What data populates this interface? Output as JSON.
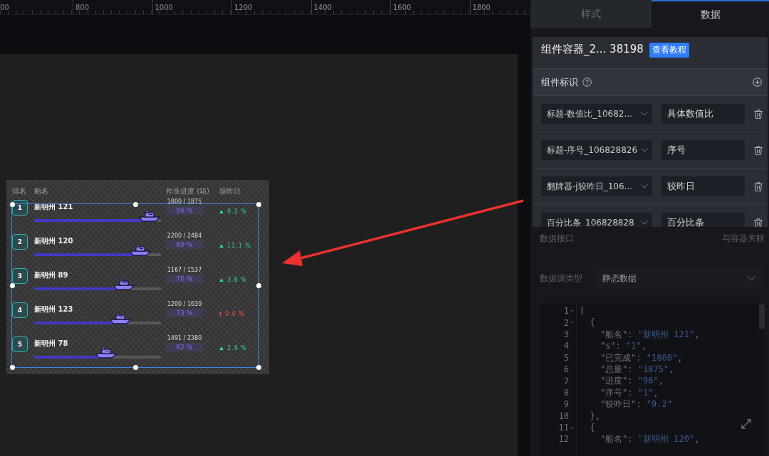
{
  "ruler": {
    "labels": [
      "00",
      "800",
      "1000",
      "1200",
      "1400",
      "1600",
      "1800"
    ]
  },
  "widget": {
    "columns": [
      "排名",
      "船名",
      "作业进度 (箱)",
      "较昨日"
    ],
    "rows": [
      {
        "rank": "1",
        "name": "新明州 121",
        "progress": "1800 / 1875",
        "level": 0.96,
        "percent": "96 %",
        "change": "9.2 %",
        "kind": "up"
      },
      {
        "rank": "2",
        "name": "新明州 120",
        "progress": "2200 / 2484",
        "level": 0.89,
        "percent": "89 %",
        "change": "11.1 %",
        "kind": "up"
      },
      {
        "rank": "3",
        "name": "新明州 89",
        "progress": "1167 / 1537",
        "level": 0.76,
        "percent": "76 %",
        "change": "3.6 %",
        "kind": "up"
      },
      {
        "rank": "4",
        "name": "新明州 123",
        "progress": "1200 / 1639",
        "level": 0.73,
        "percent": "73 %",
        "change": "0.0 %",
        "kind": "flat"
      },
      {
        "rank": "5",
        "name": "新明州 78",
        "progress": "1491 / 2389",
        "level": 0.62,
        "percent": "62 %",
        "change": "2.9 %",
        "kind": "up"
      }
    ]
  },
  "panel": {
    "tabs": [
      {
        "label": "样式",
        "selected": false
      },
      {
        "label": "数据",
        "selected": true
      }
    ],
    "component": {
      "title": "组件容器_2... 38198",
      "button": "查看教程"
    },
    "identity": {
      "title": "组件标识",
      "rows": [
        {
          "field": "标题-数值比_10682...",
          "value": "具体数值比"
        },
        {
          "field": "标题-序号_106828826",
          "value": "序号"
        },
        {
          "field": "翻牌器-j较昨日_106...",
          "value": "较昨日"
        },
        {
          "field": "百分比条_106828828",
          "value": "百分比条"
        }
      ]
    },
    "interface": {
      "title": "数据接口",
      "link": "与容器关联"
    },
    "source": {
      "label": "数据源类型",
      "value": "静态数据"
    },
    "editor": {
      "lines": [
        {
          "number": "1",
          "code": "[",
          "foldable": true
        },
        {
          "number": "2",
          "code": "  {",
          "foldable": true
        },
        {
          "number": "3",
          "code": "    \"船名\": \"新明州 121\",",
          "foldable": false
        },
        {
          "number": "4",
          "code": "    \"s\": \"1\",",
          "foldable": false
        },
        {
          "number": "5",
          "code": "    \"已完成\": \"1800\",",
          "foldable": false
        },
        {
          "number": "6",
          "code": "    \"总量\": \"1875\",",
          "foldable": false
        },
        {
          "number": "7",
          "code": "    \"进度\": \"96\",",
          "foldable": false
        },
        {
          "number": "8",
          "code": "    \"序号\": \"1\",",
          "foldable": false
        },
        {
          "number": "9",
          "code": "    \"较昨日\": \"9.2\"",
          "foldable": false
        },
        {
          "number": "10",
          "code": "  },",
          "foldable": false
        },
        {
          "number": "11",
          "code": "  {",
          "foldable": true
        },
        {
          "number": "12",
          "code": "    \"船名\": \"新明州 120\",",
          "foldable": false
        }
      ]
    }
  }
}
